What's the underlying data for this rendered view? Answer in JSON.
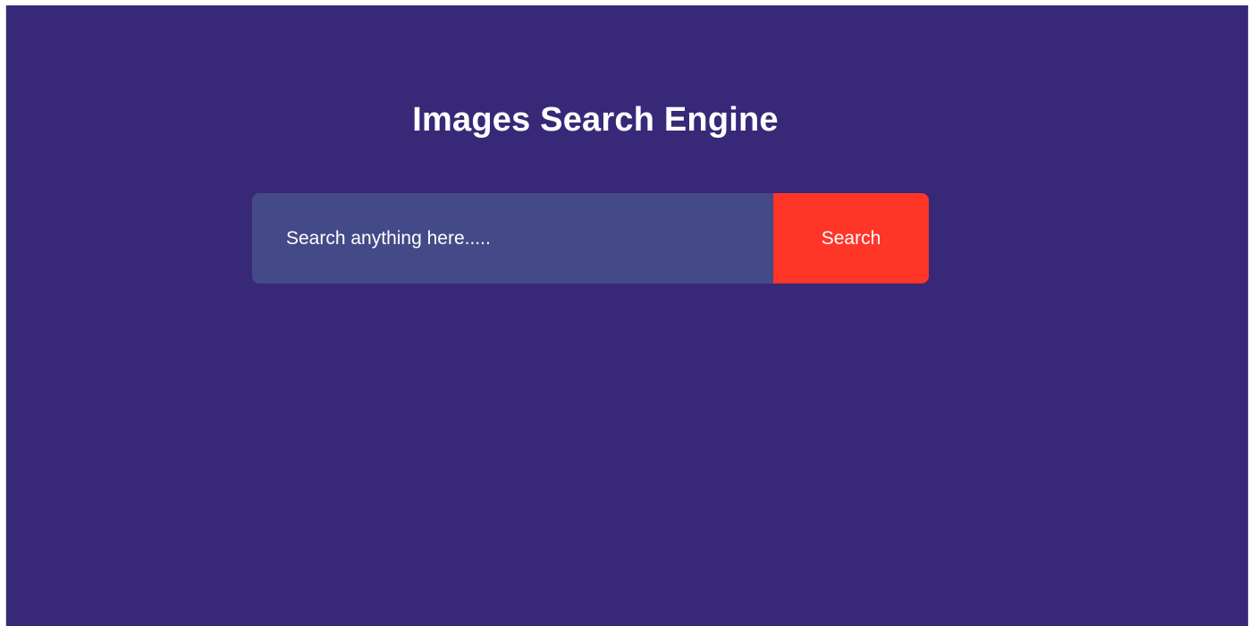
{
  "page": {
    "title": "Images Search Engine"
  },
  "search": {
    "placeholder": "Search anything here.....",
    "value": "",
    "button_label": "Search"
  },
  "colors": {
    "background": "#382878",
    "input_background": "#444a88",
    "button_background": "#ff3528",
    "text": "#ffffff"
  }
}
